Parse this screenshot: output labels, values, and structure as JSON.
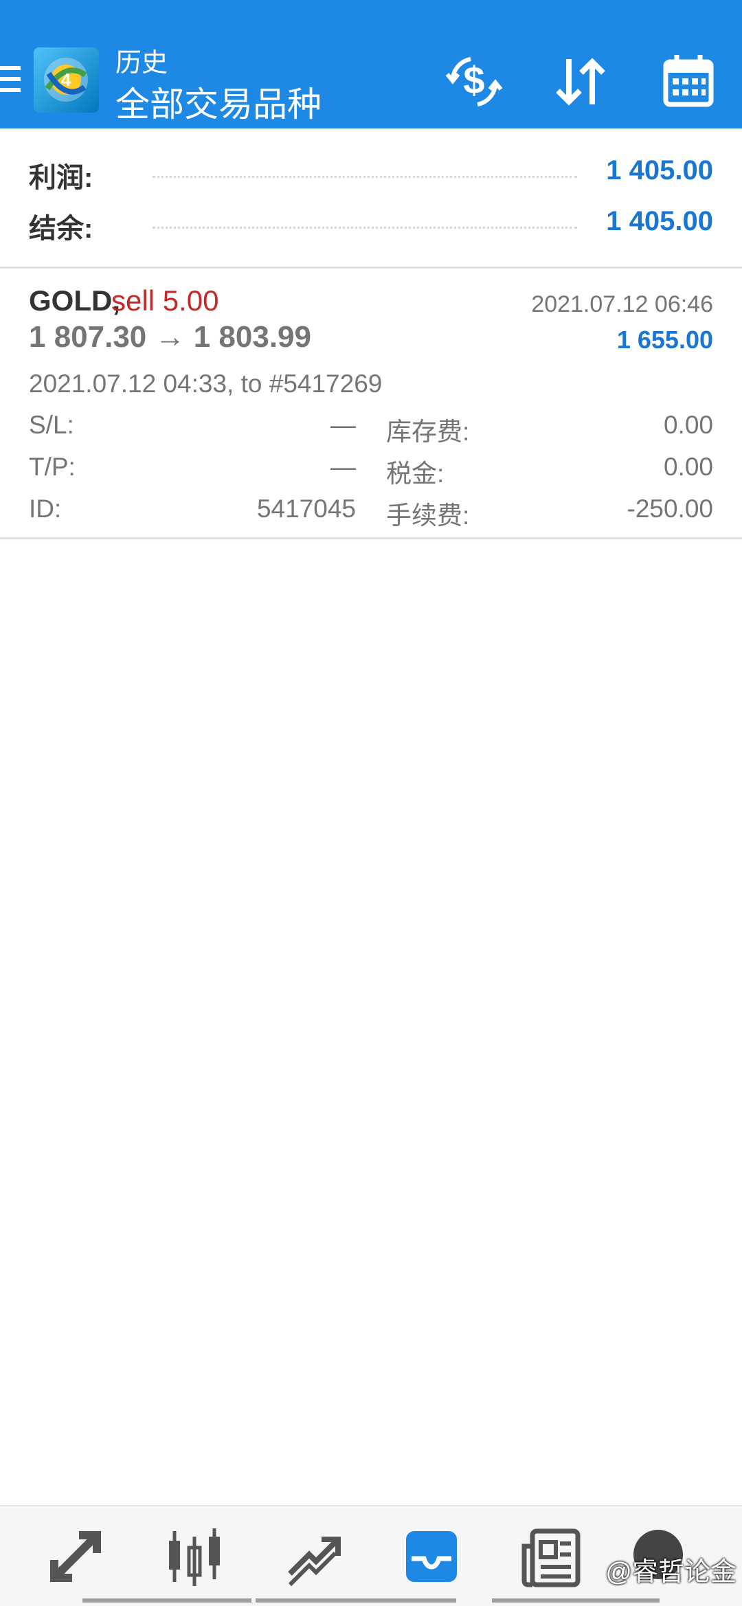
{
  "app_bar": {
    "title": "历史",
    "subtitle": "全部交易品种",
    "icons": [
      "menu-icon",
      "app-logo",
      "currency-exchange-icon",
      "sort-icon",
      "calendar-icon"
    ]
  },
  "summary": {
    "profit_label": "利润:",
    "profit_value": "1 405.00",
    "balance_label": "结余:",
    "balance_value": "1 405.00"
  },
  "deal": {
    "symbol": "GOLD,",
    "type": "sell 5.00",
    "close_time": "2021.07.12 06:46",
    "prices": "1 807.30 → 1 803.99",
    "profit": "1 655.00",
    "open_info": "2021.07.12 04:33, to #5417269",
    "sl_label": "S/L:",
    "sl_value": "—",
    "tp_label": "T/P:",
    "tp_value": "—",
    "id_label": "ID:",
    "id_value": "5417045",
    "swap_label": "库存费:",
    "swap_value": "0.00",
    "tax_label": "税金:",
    "tax_value": "0.00",
    "commission_label": "手续费:",
    "commission_value": "-250.00"
  },
  "bottom_nav": {
    "items": [
      "quotes-icon",
      "chart-icon",
      "trade-icon",
      "history-icon",
      "news-icon",
      "chat-icon"
    ],
    "active": "history-icon",
    "watermark": "@睿哲论金"
  },
  "colors": {
    "primary": "#1e88e5",
    "profit_blue": "#1976d2",
    "sell_red": "#c62828",
    "text_gray": "#757575"
  }
}
